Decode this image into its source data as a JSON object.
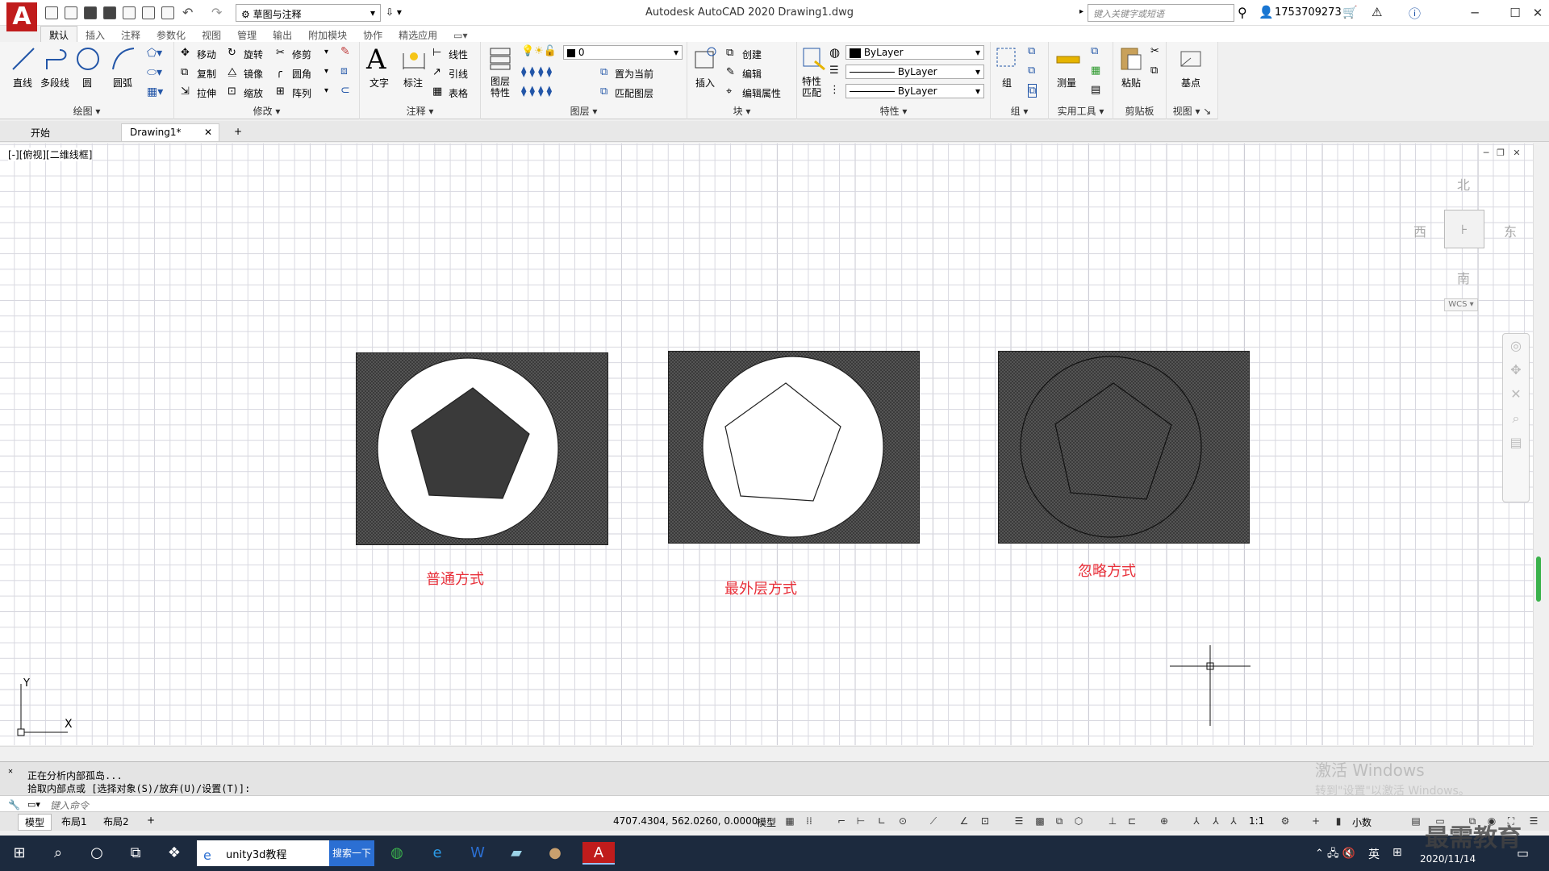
{
  "titlebar": {
    "app_logo": "A",
    "workspace": "草图与注释",
    "title": "Autodesk AutoCAD 2020    Drawing1.dwg",
    "search_placeholder": "键入关键字或短语",
    "user": "1753709273"
  },
  "ribbon_tabs": [
    "默认",
    "插入",
    "注释",
    "参数化",
    "视图",
    "管理",
    "输出",
    "附加模块",
    "协作",
    "精选应用"
  ],
  "ribbon": {
    "draw": {
      "title": "绘图",
      "line": "直线",
      "polyline": "多段线",
      "circle": "圆",
      "arc": "圆弧"
    },
    "modify": {
      "title": "修改",
      "move": "移动",
      "rotate": "旋转",
      "trim": "修剪",
      "copy": "复制",
      "mirror": "镜像",
      "fillet": "圆角",
      "stretch": "拉伸",
      "scale": "缩放",
      "array": "阵列"
    },
    "annotation": {
      "title": "注释",
      "text": "文字",
      "dimension": "标注",
      "linear": "线性",
      "leader": "引线",
      "table": "表格"
    },
    "layers": {
      "title": "图层",
      "props": "图层\n特性",
      "layer_value": "0",
      "set_current": "置为当前",
      "match_layer": "匹配图层"
    },
    "block": {
      "title": "块",
      "insert": "插入",
      "create": "创建",
      "edit": "编辑",
      "edit_attr": "编辑属性"
    },
    "properties": {
      "title": "特性",
      "match": "特性\n匹配",
      "color": "ByLayer",
      "linetype": "ByLayer",
      "lineweight": "ByLayer"
    },
    "groups": {
      "title": "组",
      "group": "组"
    },
    "utilities": {
      "title": "实用工具",
      "measure": "测量"
    },
    "clipboard": {
      "title": "剪贴板",
      "paste": "粘贴"
    },
    "view": {
      "title": "视图",
      "base": "基点"
    }
  },
  "file_tabs": {
    "start": "开始",
    "drawing": "Drawing1*",
    "add": "+"
  },
  "canvas": {
    "viewport_label": "[-][俯视][二维线框]",
    "viewcube": {
      "north": "北",
      "south": "南",
      "east": "东",
      "west": "西",
      "wcs": "WCS"
    },
    "captions": [
      "普通方式",
      "最外层方式",
      "忽略方式"
    ],
    "ucs": {
      "x": "X",
      "y": "Y"
    }
  },
  "command": {
    "history": [
      "正在分析内部孤岛...",
      "拾取内部点或 [选择对象(S)/放弃(U)/设置(T)]:"
    ],
    "placeholder": "键入命令"
  },
  "watermark": {
    "line1": "激活 Windows",
    "line2": "转到\"设置\"以激活 Windows。"
  },
  "statusbar": {
    "model": "模型",
    "layout1": "布局1",
    "layout2": "布局2",
    "add": "+",
    "coords": "4707.4304, 562.0260, 0.0000",
    "model_btn": "模型",
    "scale": "1:1",
    "units": "小数"
  },
  "taskbar": {
    "search_text": "unity3d教程",
    "search_button": "搜索一下",
    "time": "2020/11/14",
    "ime": "英",
    "brand": "最需教育"
  },
  "colors": {
    "caption": "#e8303a",
    "hatch": "#3a3a3a",
    "taskbar": "#1c2a3e",
    "logo": "#c01c1c"
  }
}
